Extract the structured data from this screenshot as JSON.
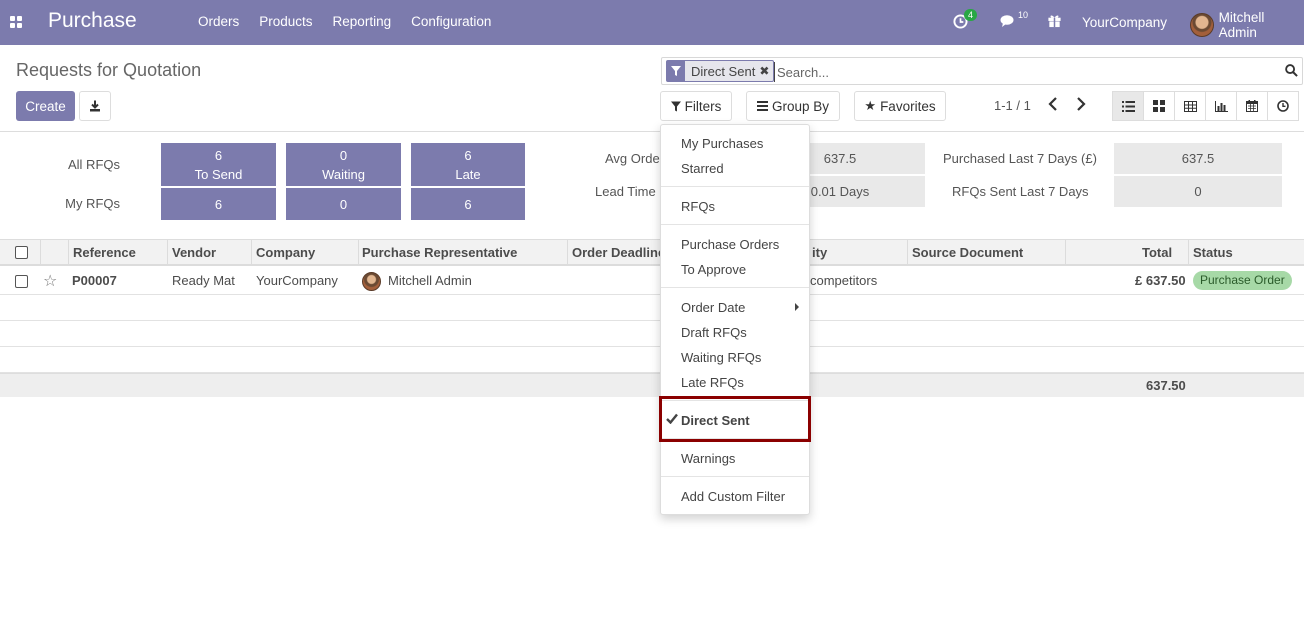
{
  "navbar": {
    "app_name": "Purchase",
    "menu": [
      "Orders",
      "Products",
      "Reporting",
      "Configuration"
    ],
    "activity_count": "4",
    "message_count": "10",
    "company": "YourCompany",
    "user": "Mitchell Admin"
  },
  "control_panel": {
    "title": "Requests for Quotation",
    "create_label": "Create",
    "search": {
      "facet_label": "Direct Sent",
      "placeholder": "Search..."
    },
    "filters_label": "Filters",
    "group_by_label": "Group By",
    "favorites_label": "Favorites",
    "pager": "1-1 / 1"
  },
  "dashboard": {
    "row_labels": [
      "All RFQs",
      "My RFQs"
    ],
    "tiles": [
      {
        "all_value": "6",
        "label": "To Send",
        "my_value": "6"
      },
      {
        "all_value": "0",
        "label": "Waiting",
        "my_value": "0"
      },
      {
        "all_value": "6",
        "label": "Late",
        "my_value": "6"
      }
    ],
    "stats": {
      "avg_order_label": "Avg Orde",
      "avg_order_value": "637.5",
      "lead_time_label": "Lead Time",
      "lead_time_value": "0.01  Days",
      "purchased_label": "Purchased Last 7 Days (£)",
      "purchased_value": "637.5",
      "sent_label": "RFQs Sent Last 7 Days",
      "sent_value": "0"
    }
  },
  "table": {
    "headers": {
      "reference": "Reference",
      "vendor": "Vendor",
      "company": "Company",
      "representative": "Purchase Representative",
      "deadline": "Order Deadline",
      "activity": "ity",
      "source": "Source Document",
      "total": "Total",
      "status": "Status"
    },
    "rows": [
      {
        "reference": "P00007",
        "vendor": "Ready Mat",
        "company": "YourCompany",
        "representative": "Mitchell Admin",
        "activity": "competitors",
        "total": "£ 637.50",
        "status": "Purchase Order"
      }
    ],
    "footer_total": "637.50"
  },
  "filters_dropdown": {
    "items": {
      "my_purchases": "My Purchases",
      "starred": "Starred",
      "rfqs": "RFQs",
      "purchase_orders": "Purchase Orders",
      "to_approve": "To Approve",
      "order_date": "Order Date",
      "draft_rfqs": "Draft RFQs",
      "waiting_rfqs": "Waiting RFQs",
      "late_rfqs": "Late RFQs",
      "direct_sent": "Direct Sent",
      "warnings": "Warnings",
      "add_custom_filter": "Add Custom Filter"
    },
    "active_item": "direct_sent"
  },
  "colors": {
    "brand": "#7c7bad",
    "highlight_border": "#8b0000",
    "status_badge_bg": "#a7d9a7"
  }
}
